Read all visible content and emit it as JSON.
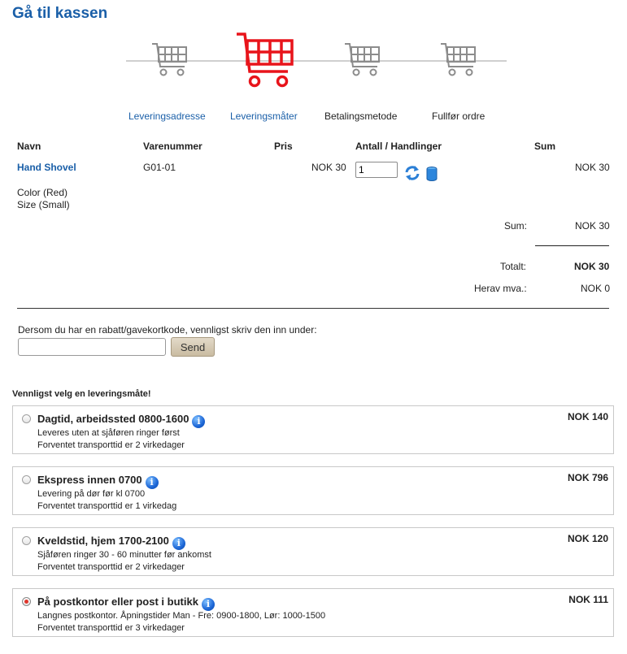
{
  "page": {
    "title": "Gå til kassen"
  },
  "steps": [
    {
      "label": "Leveringsadresse",
      "state": "done"
    },
    {
      "label": "Leveringsmåter",
      "state": "active"
    },
    {
      "label": "Betalingsmetode",
      "state": "pending"
    },
    {
      "label": "Fullfør ordre",
      "state": "pending"
    }
  ],
  "cart": {
    "headers": {
      "name": "Navn",
      "sku": "Varenummer",
      "price": "Pris",
      "qty": "Antall / Handlinger",
      "sum": "Sum"
    },
    "item": {
      "name": "Hand Shovel",
      "sku": "G01-01",
      "price": "NOK 30",
      "quantity": "1",
      "sum": "NOK 30",
      "attributes": [
        "Color (Red)",
        "Size (Small)"
      ],
      "actions": {
        "update_icon": "refresh-icon",
        "delete_icon": "trash-icon"
      }
    },
    "totals": {
      "sum_label": "Sum:",
      "sum_value": "NOK 30",
      "total_label": "Totalt:",
      "total_value": "NOK 30",
      "vat_label": "Herav mva.:",
      "vat_value": "NOK 0"
    }
  },
  "coupon": {
    "prompt": "Dersom du har en rabatt/gavekortkode, vennligst skriv den inn under:",
    "value": "",
    "button": "Send"
  },
  "shipping": {
    "heading": "Vennligst velg en leveringsmåte!",
    "options": [
      {
        "title": "Dagtid, arbeidssted 0800-1600",
        "line1": "Leveres uten at sjåføren ringer først",
        "line2": "Forventet transporttid er 2 virkedager",
        "price": "NOK 140",
        "selected": false
      },
      {
        "title": "Ekspress innen 0700",
        "line1": "Levering på dør før kl 0700",
        "line2": "Forventet transporttid er 1 virkedag",
        "price": "NOK 796",
        "selected": false
      },
      {
        "title": "Kveldstid, hjem 1700-2100",
        "line1": "Sjåføren ringer 30 - 60 minutter før ankomst",
        "line2": "Forventet transporttid er 2 virkedager",
        "price": "NOK 120",
        "selected": false
      },
      {
        "title": "På postkontor eller post i butikk",
        "line1": "Langnes postkontor. Åpningstider Man - Fre: 0900-1800, Lør: 1000-1500",
        "line2": "Forventet transporttid er 3 virkedager",
        "price": "NOK 111",
        "selected": true
      }
    ]
  },
  "colors": {
    "link": "#1a5fa8",
    "active_step": "#e8141b",
    "inactive_step": "#8c8c8c"
  }
}
